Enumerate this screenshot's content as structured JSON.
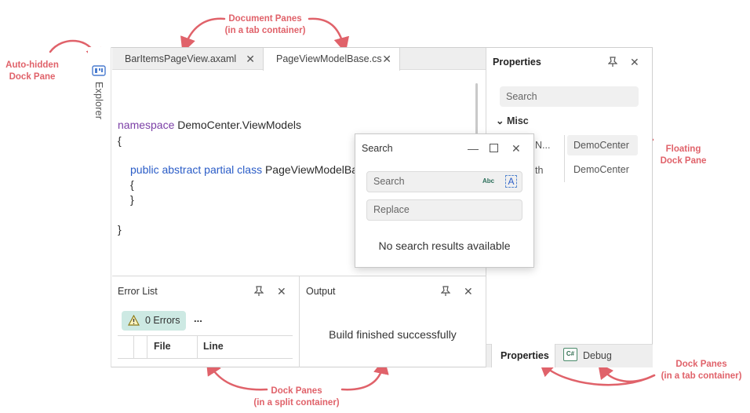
{
  "annotations": {
    "auto_hidden": [
      "Auto-hidden",
      "Dock Pane"
    ],
    "document_panes": [
      "Document Panes",
      "(in a tab container)"
    ],
    "floating": [
      "Floating",
      "Dock Pane"
    ],
    "split_panes": [
      "Dock Panes",
      "(in a split container)"
    ],
    "tab_panes": [
      "Dock Panes",
      "(in a tab container)"
    ],
    "color": "#e0626a"
  },
  "explorer": {
    "label": "Explorer",
    "icon": "explorer-icon"
  },
  "document_tabs": [
    {
      "label": "BarItemsPageView.axaml",
      "active": false
    },
    {
      "label": "PageViewModelBase.cs",
      "active": true
    }
  ],
  "code": {
    "line1_kw": "namespace",
    "line1_rest": " DemoCenter.ViewModels",
    "line2": "{",
    "line3_kw": "public abstract partial class",
    "line3_rest": " PageViewModelBase",
    "line4": "{",
    "line5": "}",
    "line6": "}"
  },
  "error_list": {
    "title": "Error List",
    "errors_label": "0 Errors",
    "more": "...",
    "columns": [
      "File",
      "Line"
    ]
  },
  "output": {
    "title": "Output",
    "message": "Build finished successfully"
  },
  "properties": {
    "title": "Properties",
    "search_placeholder": "Search",
    "category": "Misc",
    "rows": [
      {
        "name": "N...",
        "value": "DemoCenter"
      },
      {
        "name": "th",
        "value": "DemoCenter"
      }
    ]
  },
  "bottom_tabs": [
    {
      "label": "Properties",
      "active": true
    },
    {
      "label": "Debug",
      "active": false,
      "icon": "C#"
    }
  ],
  "search_window": {
    "title": "Search",
    "search_placeholder": "Search",
    "replace_placeholder": "Replace",
    "case_toggle": "Abc",
    "word_toggle": "A",
    "no_results": "No search results available"
  },
  "colors": {
    "keyword": "#7b3fa6",
    "type_keyword": "#2a5cc7",
    "badge": "#cde9e3"
  }
}
